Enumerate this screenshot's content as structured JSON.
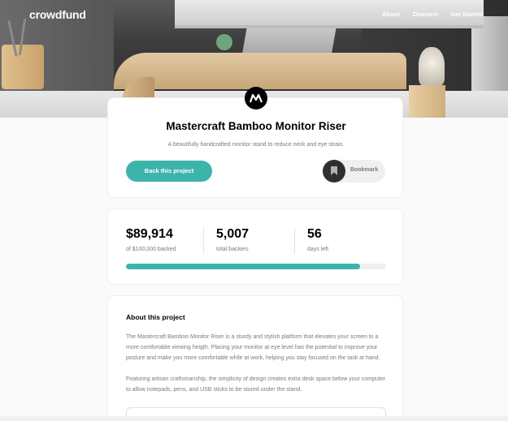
{
  "nav": {
    "logo": "crowdfund",
    "links": [
      "About",
      "Discover",
      "Get Started"
    ]
  },
  "project": {
    "logo_icon": "mastercraft-logo-icon",
    "title": "Mastercraft Bamboo Monitor Riser",
    "subtitle": "A beautifully handcrafted monitor stand to reduce neck and eye strain.",
    "back_button": "Back this project",
    "bookmark_button": "Bookmark",
    "bookmark_icon": "bookmark-icon"
  },
  "stats": {
    "items": [
      {
        "value": "$89,914",
        "label": "of $100,000 backed"
      },
      {
        "value": "5,007",
        "label": "total backers"
      },
      {
        "value": "56",
        "label": "days left"
      }
    ],
    "progress_fraction": 0.899
  },
  "about": {
    "title": "About this project",
    "paragraphs": [
      "The Mastercraft Bamboo Monitor Riser is a sturdy and stylish platform that elevates your screen to a more comfortable viewing heigth. Placing your monitor at eye level has the potential to improve your posture and make you more comfortable while at work, helping you stay focused on the task at hand.",
      "Featuring artisan craftsmanship, the simplicity of design creates extra desk space below your computer to allow notepads, pens, and USB sticks to be stored under the stand."
    ]
  },
  "colors": {
    "accent": "#3cb4ac",
    "text_dark": "#000000",
    "text_muted": "#7a7a7a",
    "bookmark_dark": "#2f2f2f"
  }
}
